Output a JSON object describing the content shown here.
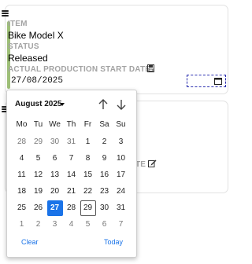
{
  "record": {
    "item_label": "ITEM",
    "item_value": "Bike Model X",
    "status_label": "STATUS",
    "status_value": "Released",
    "start_date_label": "ACTUAL PRODUCTION START DATE",
    "start_date_value": "27/08/2025"
  },
  "second_card": {
    "partial_label": "TE"
  },
  "datepicker": {
    "month_label": "August 2025",
    "weekdays": [
      "Mo",
      "Tu",
      "We",
      "Th",
      "Fr",
      "Sa",
      "Su"
    ],
    "weeks": [
      [
        "28",
        "29",
        "30",
        "31",
        "1",
        "2",
        "3"
      ],
      [
        "4",
        "5",
        "6",
        "7",
        "8",
        "9",
        "10"
      ],
      [
        "11",
        "12",
        "13",
        "14",
        "15",
        "16",
        "17"
      ],
      [
        "18",
        "19",
        "20",
        "21",
        "22",
        "23",
        "24"
      ],
      [
        "25",
        "26",
        "27",
        "28",
        "29",
        "30",
        "31"
      ],
      [
        "1",
        "2",
        "3",
        "4",
        "5",
        "6",
        "7"
      ]
    ],
    "selected_day": "27",
    "today_day": "29",
    "clear_label": "Clear",
    "today_label": "Today"
  },
  "colors": {
    "accent_bar": "#9ebf78",
    "selected": "#1a73e8",
    "link": "#1a73e8",
    "label_gray": "#a3a3a3"
  },
  "icons": {
    "drag_handle": "menu-icon",
    "save": "save-icon",
    "calendar": "calendar-icon",
    "edit": "edit-icon",
    "prev": "arrow-up-icon",
    "next": "arrow-down-icon"
  }
}
